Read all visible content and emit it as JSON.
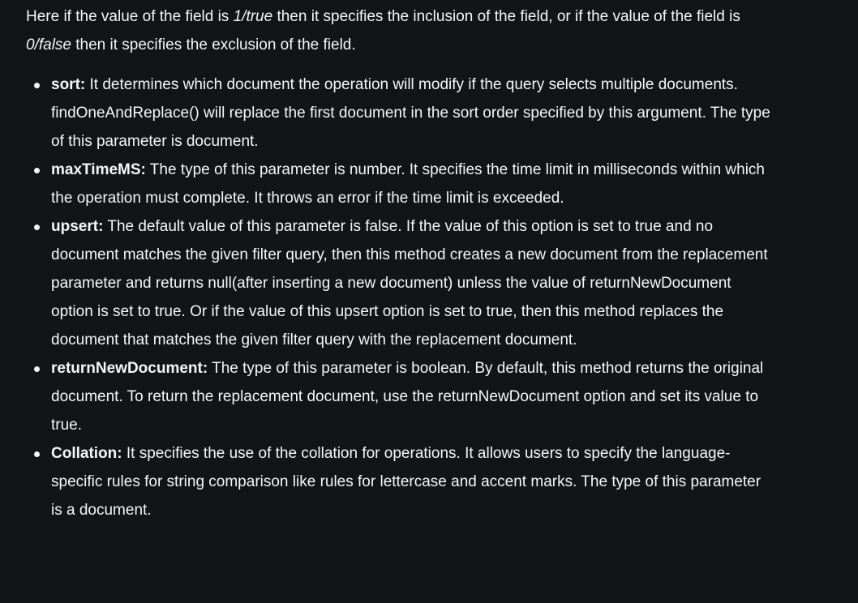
{
  "intro": {
    "part1": "Here if the value of the field is ",
    "em1": "1/true",
    "part2": " then it specifies the inclusion of the field, or if the value of the field is ",
    "em2": "0/false",
    "part3": " then it specifies the exclusion of the field."
  },
  "items": [
    {
      "term": "sort:",
      "text": " It determines which document the operation will modify if the query selects multiple documents. findOneAndReplace() will replace the first document in the sort order specified by this argument. The type of this parameter is document."
    },
    {
      "term": "maxTimeMS:",
      "text": " The type of this parameter is number. It specifies the time limit in milliseconds within which the operation must complete. It throws an error if the time limit is exceeded."
    },
    {
      "term": "upsert:",
      "text": " The default value of this parameter is false. If the value of this option is set to true and no document matches the given filter query, then this method creates a new document from the replacement parameter and returns null(after inserting a new document) unless the value of returnNewDocument option is set to true. Or if the value of this upsert option is set to true, then this method replaces the document that matches the given filter query with the replacement document."
    },
    {
      "term": "returnNewDocument:",
      "text": " The type of this parameter is boolean. By default, this method returns the original document. To return the replacement document, use the returnNewDocument option and set its value to true."
    },
    {
      "term": "Collation:",
      "text": " It specifies the use of the collation for operations. It allows users to specify the language-specific rules for string comparison like rules for lettercase and accent marks. The type of this parameter is a document."
    }
  ]
}
